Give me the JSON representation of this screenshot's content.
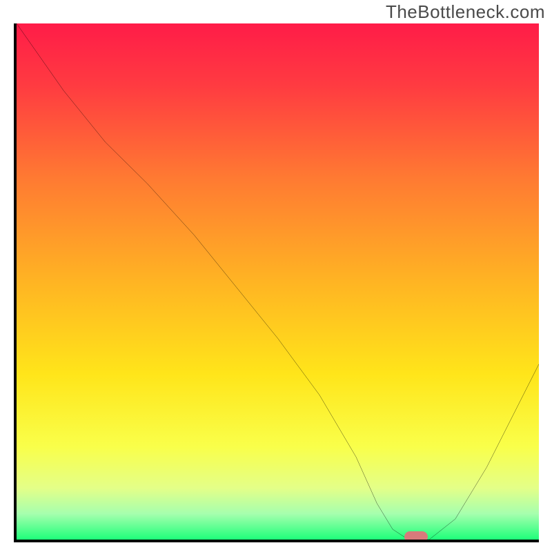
{
  "watermark": "TheBottleneck.com",
  "chart_data": {
    "type": "line",
    "title": "",
    "xlabel": "",
    "ylabel": "",
    "xlim": [
      0,
      100
    ],
    "ylim": [
      0,
      100
    ],
    "x": [
      0,
      9,
      17,
      25,
      34,
      42,
      50,
      58,
      65,
      69,
      72,
      75,
      79,
      84,
      90,
      95,
      100
    ],
    "values": [
      100,
      87,
      77,
      69,
      59,
      49,
      39,
      28,
      16,
      7,
      2,
      0,
      0,
      4,
      14,
      24,
      34
    ],
    "marker": {
      "x": 76.5,
      "y": 0,
      "label": ""
    },
    "gradient_stops": [
      {
        "pos": 0,
        "color": "#ff1c48"
      },
      {
        "pos": 0.12,
        "color": "#ff3b41"
      },
      {
        "pos": 0.3,
        "color": "#ff7a32"
      },
      {
        "pos": 0.5,
        "color": "#ffb423"
      },
      {
        "pos": 0.68,
        "color": "#ffe51a"
      },
      {
        "pos": 0.82,
        "color": "#f9ff4a"
      },
      {
        "pos": 0.9,
        "color": "#e4ff88"
      },
      {
        "pos": 0.95,
        "color": "#a6ffae"
      },
      {
        "pos": 1.0,
        "color": "#1eff7a"
      }
    ]
  }
}
